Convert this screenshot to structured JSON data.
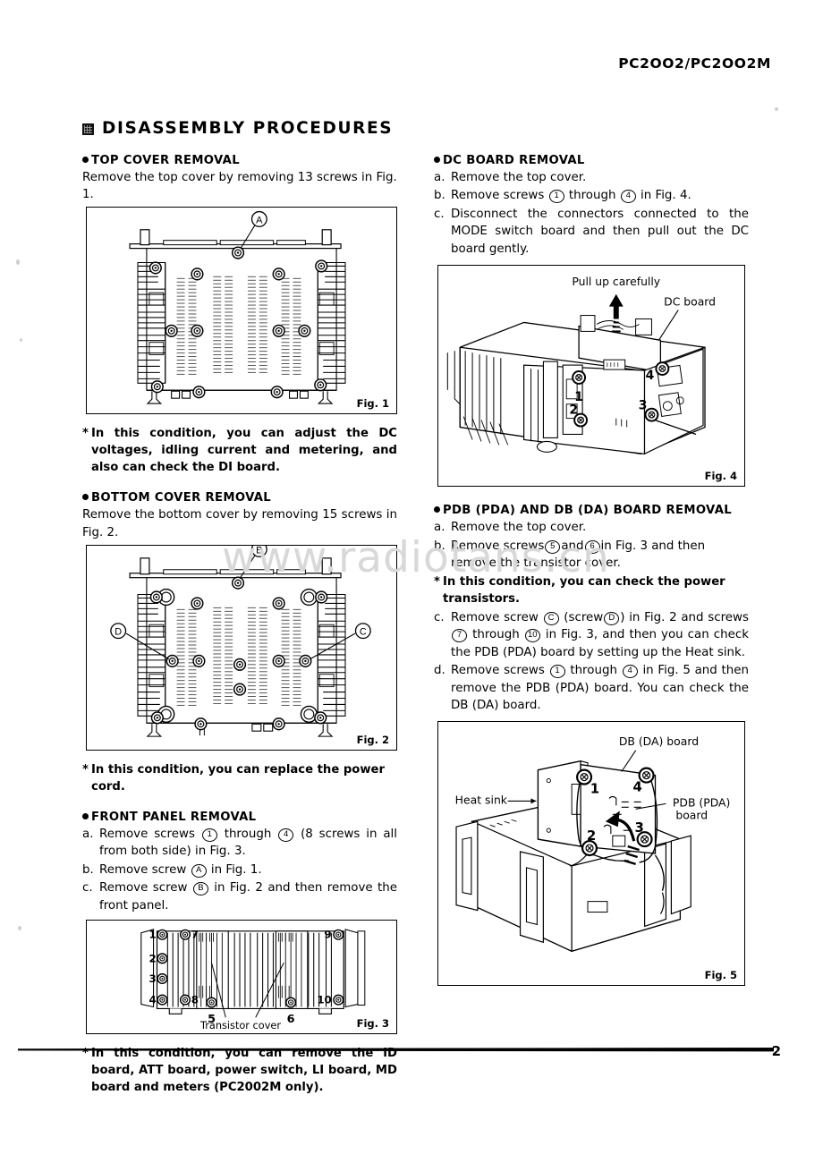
{
  "header": {
    "model": "PC2OO2/PC2OO2M",
    "page_number": "2"
  },
  "section": {
    "title": "DISASSEMBLY PROCEDURES"
  },
  "watermark": {
    "text": "www.radiotans.cn"
  },
  "left_column": {
    "top_cover": {
      "heading": "TOP COVER REMOVAL",
      "body": "Remove the top cover by removing 13 screws in Fig. 1.",
      "note": "In this condition, you can adjust the DC voltages, idling current and metering, and also can check the DI board."
    },
    "bottom_cover": {
      "heading": "BOTTOM COVER REMOVAL",
      "body": "Remove the bottom cover by removing 15 screws in Fig. 2.",
      "note": "In this condition, you can replace the power cord."
    },
    "front_panel": {
      "heading": "FRONT PANEL REMOVAL",
      "steps": [
        {
          "label": "a.",
          "pre": "Remove screws",
          "c1": "1",
          "mid": "through",
          "c2": "4",
          "post": "(8 screws in all from both side) in Fig. 3."
        },
        {
          "label": "b.",
          "pre": "Remove screw",
          "c1": "A",
          "mid": "",
          "c2": "",
          "post": "in Fig. 1."
        },
        {
          "label": "c.",
          "pre": "Remove screw",
          "c1": "B",
          "mid": "",
          "c2": "",
          "post": "in Fig. 2 and then remove the front panel."
        }
      ],
      "note": "In this condition, you can remove the ID board, ATT board, power switch, LI board, MD board and meters (PC2002M only)."
    }
  },
  "right_column": {
    "dc_board": {
      "heading": "DC BOARD REMOVAL",
      "steps": [
        {
          "label": "a.",
          "pre": "Remove the top cover.",
          "c1": "",
          "mid": "",
          "c2": "",
          "post": ""
        },
        {
          "label": "b.",
          "pre": "Remove screws",
          "c1": "1",
          "mid": "through",
          "c2": "4",
          "post": "in Fig. 4."
        },
        {
          "label": "c.",
          "pre": "Disconnect the connectors connected to the MODE switch board and then pull out the DC board gently.",
          "c1": "",
          "mid": "",
          "c2": "",
          "post": ""
        }
      ]
    },
    "pdb_db_board": {
      "heading": "PDB (PDA) AND DB (DA) BOARD REMOVAL",
      "step_a": {
        "label": "a.",
        "text": "Remove the top cover."
      },
      "step_b": {
        "label": "b.",
        "pre": "Remove screws",
        "c1": "5",
        "mid": "and",
        "c2": "6",
        "post": "in Fig. 3 and then remove the transistor cover."
      },
      "note": "In this condition, you can check the power transistors.",
      "step_c": {
        "label": "c.",
        "pre": "Remove screw",
        "c1": "C",
        "mid": "(screw",
        "c2": "D",
        "mid2": ") in Fig. 2 and screws",
        "c3": "7",
        "mid3": "through",
        "c4": "10",
        "post": "in Fig. 3, and then you can check the PDB (PDA) board by setting up the Heat sink."
      },
      "step_d": {
        "label": "d.",
        "pre": "Remove screws",
        "c1": "1",
        "mid": "through",
        "c2": "4",
        "post": "in Fig. 5 and then remove the PDB (PDA) board. You can check the DB (DA) board."
      }
    }
  },
  "figures": {
    "fig1": {
      "caption": "Fig. 1",
      "view": "top view of chassis with heat sinks and ventilation slots",
      "callouts": [
        {
          "label": "A",
          "desc": "top cover center screw"
        }
      ],
      "screw_count": 13
    },
    "fig2": {
      "caption": "Fig. 2",
      "view": "bottom view of chassis with heat sinks and ventilation slots",
      "callouts": [
        {
          "label": "B",
          "desc": "front panel screw"
        },
        {
          "label": "C",
          "desc": "right heat sink screw"
        },
        {
          "label": "D",
          "desc": "left heat sink screw"
        }
      ],
      "screw_count": 15
    },
    "fig3": {
      "caption": "Fig. 3",
      "view": "rear view of chassis",
      "screw_numbers": [
        "1",
        "2",
        "3",
        "4",
        "5",
        "6",
        "7",
        "8",
        "9",
        "10"
      ],
      "labels": [
        {
          "text": "Transistor cover"
        }
      ]
    },
    "fig4": {
      "caption": "Fig. 4",
      "view": "isometric view, DC board removal",
      "labels": [
        {
          "text": "Pull up carefully"
        },
        {
          "text": "DC board"
        }
      ],
      "screw_numbers": [
        "1",
        "2",
        "3",
        "4"
      ]
    },
    "fig5": {
      "caption": "Fig. 5",
      "view": "isometric view, PDB/DB board removal with heat sink tilted up",
      "labels": [
        {
          "text": "Heat sink"
        },
        {
          "text": "DB (DA) board"
        },
        {
          "text": "PDB (PDA)"
        },
        {
          "text": "board"
        }
      ],
      "screw_numbers": [
        "1",
        "2",
        "3",
        "4"
      ]
    }
  }
}
